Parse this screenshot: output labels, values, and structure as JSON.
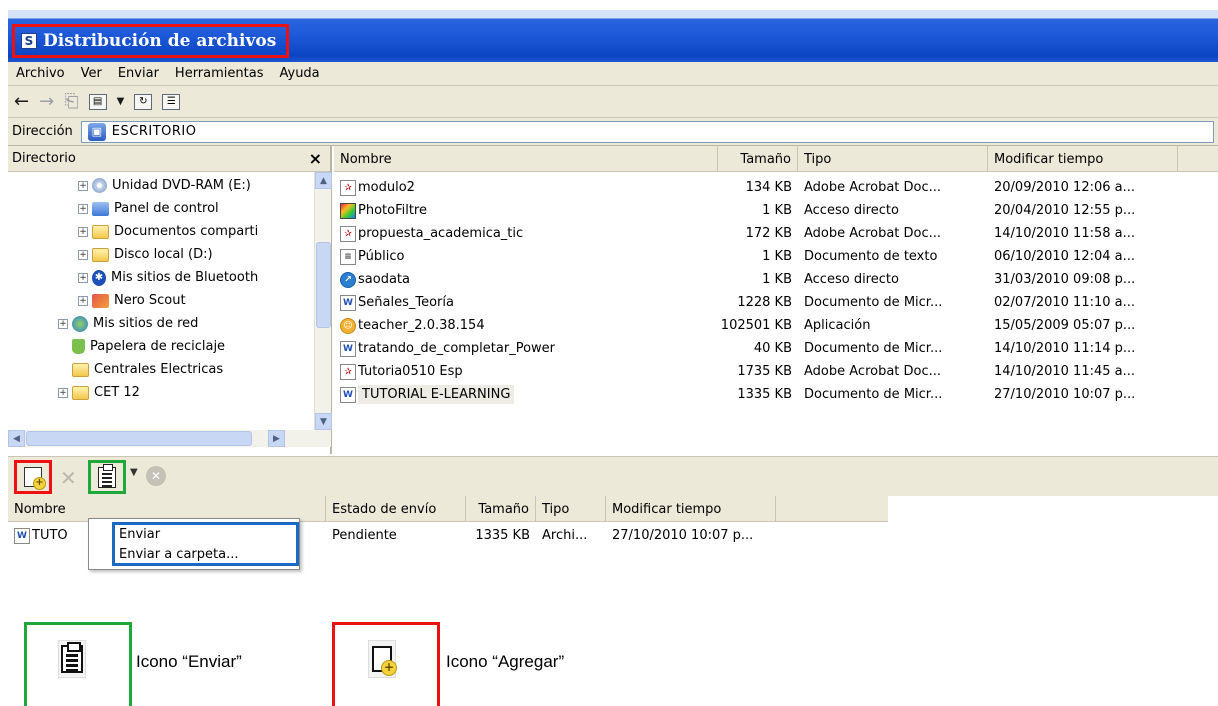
{
  "window": {
    "title": "Distribución de archivos",
    "title_icon": "S"
  },
  "menu": [
    "Archivo",
    "Ver",
    "Enviar",
    "Herramientas",
    "Ayuda"
  ],
  "toolbar": {
    "icons": [
      "back-arrow-icon",
      "forward-arrow-icon",
      "up-folder-icon",
      "view-icon",
      "dropdown-icon",
      "refresh-icon",
      "properties-icon"
    ]
  },
  "address": {
    "label": "Dirección",
    "value": "ESCRITORIO"
  },
  "tree": {
    "header": "Directorio",
    "close": "×",
    "items": [
      {
        "label": "Unidad DVD-RAM (E:)",
        "icon": "dvd-drive-icon"
      },
      {
        "label": "Panel de control",
        "icon": "control-panel-icon"
      },
      {
        "label": "Documentos comparti",
        "icon": "folder-icon"
      },
      {
        "label": "Disco local (D:)",
        "icon": "folder-icon"
      },
      {
        "label": "Mis sitios de Bluetooth",
        "icon": "bluetooth-icon"
      },
      {
        "label": "Nero Scout",
        "icon": "nero-icon"
      },
      {
        "label": "Mis sitios de red",
        "icon": "network-icon"
      },
      {
        "label": "Papelera de reciclaje",
        "icon": "recycle-bin-icon"
      },
      {
        "label": "Centrales Electricas",
        "icon": "folder-icon"
      },
      {
        "label": "CET 12",
        "icon": "folder-icon"
      }
    ]
  },
  "files": {
    "columns": [
      "Nombre",
      "Tamaño",
      "Tipo",
      "Modificar tiempo"
    ],
    "rows": [
      {
        "name": "modulo2",
        "size": "134 KB",
        "type": "Adobe Acrobat Doc...",
        "modified": "20/09/2010 12:06 a...",
        "icon": "pdf"
      },
      {
        "name": "PhotoFiltre",
        "size": "1 KB",
        "type": "Acceso directo",
        "modified": "20/04/2010 12:55 p...",
        "icon": "photo"
      },
      {
        "name": "propuesta_academica_tic",
        "size": "172 KB",
        "type": "Adobe Acrobat Doc...",
        "modified": "14/10/2010 11:58 a...",
        "icon": "pdf"
      },
      {
        "name": "Público",
        "size": "1 KB",
        "type": "Documento de texto",
        "modified": "06/10/2010 12:04 a...",
        "icon": "txt"
      },
      {
        "name": "saodata",
        "size": "1 KB",
        "type": "Acceso directo",
        "modified": "31/03/2010 09:08 p...",
        "icon": "link"
      },
      {
        "name": "Señales_Teoría",
        "size": "1228 KB",
        "type": "Documento de Micr...",
        "modified": "02/07/2010 11:10 a...",
        "icon": "word"
      },
      {
        "name": "teacher_2.0.38.154",
        "size": "102501 KB",
        "type": "Aplicación",
        "modified": "15/05/2009 05:07 p...",
        "icon": "app"
      },
      {
        "name": "tratando_de_completar_Power",
        "size": "40 KB",
        "type": "Documento de Micr...",
        "modified": "14/10/2010 11:14 p...",
        "icon": "word"
      },
      {
        "name": "Tutoria0510 Esp",
        "size": "1735 KB",
        "type": "Adobe Acrobat Doc...",
        "modified": "14/10/2010 11:45 a...",
        "icon": "pdf"
      },
      {
        "name": "TUTORIAL  E-LEARNING",
        "size": "1335 KB",
        "type": "Documento de Micr...",
        "modified": "27/10/2010 10:07 p...",
        "icon": "word"
      }
    ]
  },
  "queue": {
    "columns": [
      "Nombre",
      "Estado de envío",
      "Tamaño",
      "Tipo",
      "Modificar tiempo"
    ],
    "row": {
      "name": "TUTO",
      "status": "Pendiente",
      "size": "1335 KB",
      "type": "Archi...",
      "modified": "27/10/2010 10:07 p..."
    }
  },
  "context_menu": [
    "Enviar",
    "Enviar a carpeta..."
  ],
  "legend": {
    "send": "Icono “Enviar”",
    "add": "Icono “Agregar”"
  },
  "colors": {
    "title_bar": "#0c45c4",
    "highlight_red": "#ee1111",
    "highlight_green": "#1fa83a",
    "highlight_blue": "#1a69c4",
    "chrome": "#ece9d8"
  }
}
